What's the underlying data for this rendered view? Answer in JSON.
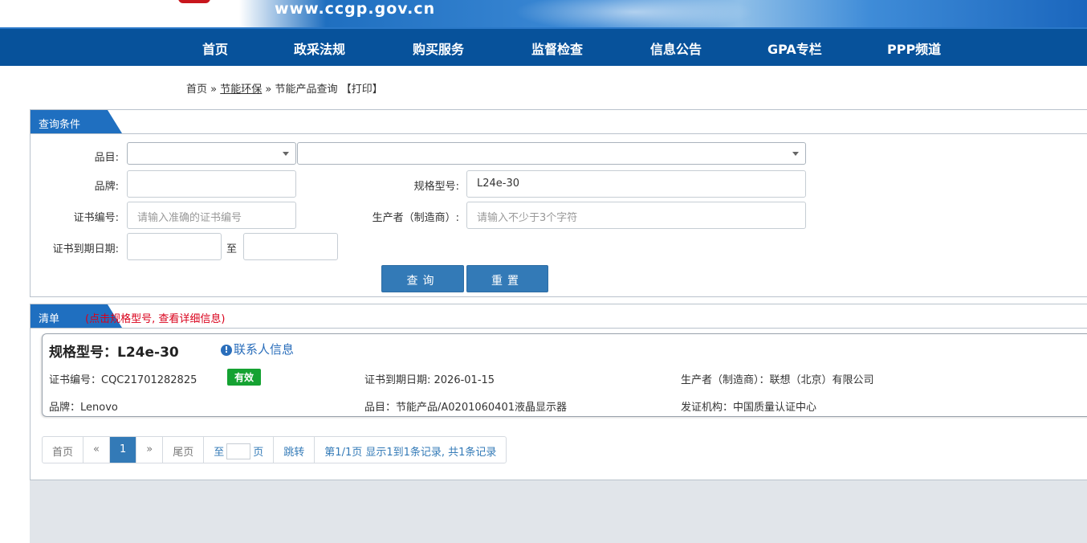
{
  "header": {
    "url": "www.ccgp.gov.cn"
  },
  "nav": {
    "items": [
      "首页",
      "政采法规",
      "购买服务",
      "监督检查",
      "信息公告",
      "GPA专栏",
      "PPP频道"
    ]
  },
  "breadcrumb": {
    "home": "首页",
    "sep1": "»",
    "section": "节能环保",
    "sep2": "»",
    "page": "节能产品查询",
    "print": "【打印】"
  },
  "query": {
    "tab_label": "查询条件",
    "category_label": "品目:",
    "brand_label": "品牌:",
    "model_label": "规格型号:",
    "model_value": "L24e-30",
    "cert_no_label": "证书编号:",
    "cert_no_placeholder": "请输入准确的证书编号",
    "maker_label": "生产者（制造商）:",
    "maker_placeholder": "请输入不少于3个字符",
    "expiry_label": "证书到期日期:",
    "to_label": "至",
    "search_button": "查询",
    "reset_button": "重置"
  },
  "list": {
    "tab_label": "清单",
    "hint": "(点击规格型号, 查看详细信息)",
    "result": {
      "title": "规格型号：L24e-30",
      "contact_link": "联系人信息",
      "cert_no": "证书编号：CQC21701282825",
      "status": "有效",
      "expiry": "证书到期日期: 2026-01-15",
      "maker": "生产者（制造商）：联想（北京）有限公司",
      "brand": "品牌：Lenovo",
      "category": "品目：节能产品/A0201060401液晶显示器",
      "issuer": "发证机构：中国质量认证中心"
    }
  },
  "pager": {
    "first": "首页",
    "prev": "«",
    "current": "1",
    "next": "»",
    "last": "尾页",
    "to": "至",
    "page_unit": "页",
    "jump": "跳转",
    "summary": "第1/1页  显示1到1条记录, 共1条记录"
  },
  "colors": {
    "nav_bg": "#07529b",
    "accent": "#337ab7",
    "valid_badge": "#15a232",
    "hint": "#d9001b"
  }
}
